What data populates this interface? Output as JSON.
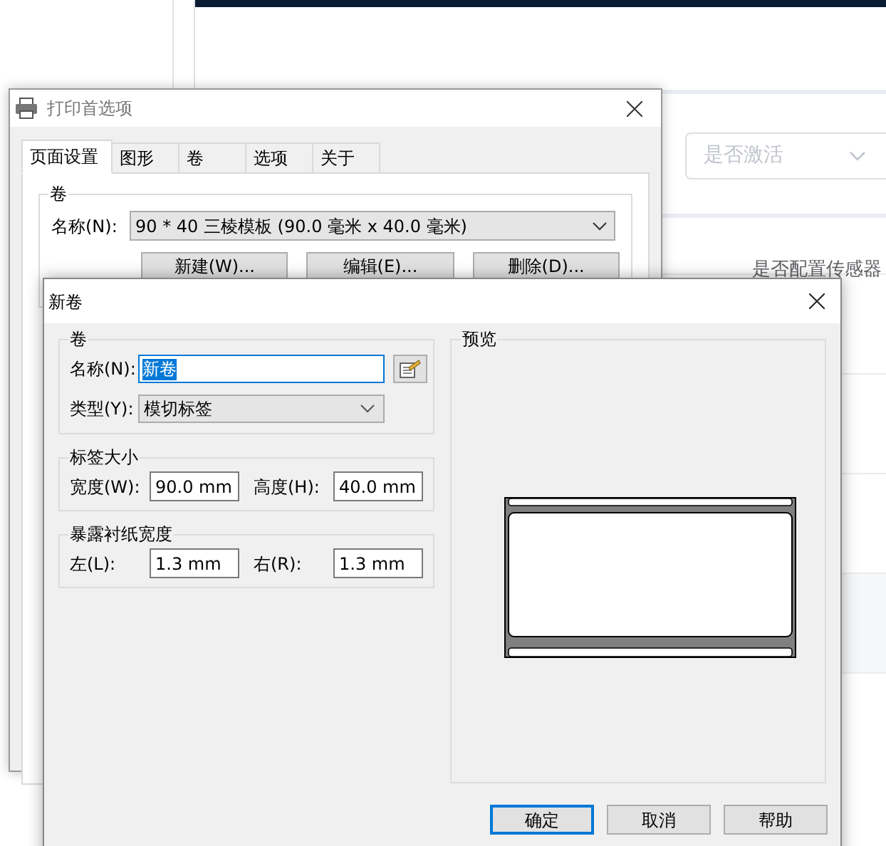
{
  "background_page": {
    "filter_select": {
      "placeholder": "是否激活"
    },
    "table": {
      "columns": [
        "是否配置传感器"
      ]
    }
  },
  "print_preferences_dialog": {
    "title": "打印首选项",
    "tabs": [
      {
        "label": "页面设置",
        "selected": true
      },
      {
        "label": "图形",
        "selected": false
      },
      {
        "label": "卷",
        "selected": false
      },
      {
        "label": "选项",
        "selected": false
      },
      {
        "label": "关于",
        "selected": false
      }
    ],
    "roll_group": {
      "title": "卷",
      "name_label": "名称(N):",
      "name_value": "90 * 40 三棱模板 (90.0 毫米 x 40.0 毫米)",
      "buttons": [
        "新建(W)...",
        "编辑(E)...",
        "删除(D)..."
      ]
    }
  },
  "new_roll_dialog": {
    "title": "新卷",
    "roll_group": {
      "title": "卷",
      "name_label": "名称(N):",
      "name_value": "新卷",
      "name_selected": true,
      "type_label": "类型(Y):",
      "type_value": "模切标签"
    },
    "label_size": {
      "title": "标签大小",
      "fields": [
        {
          "label": "宽度(W):",
          "value": "90.0 mm"
        },
        {
          "label": "高度(H):",
          "value": "40.0 mm"
        }
      ]
    },
    "exposed_liner_width": {
      "title": "暴露衬纸宽度",
      "fields": [
        {
          "label": "左(L):",
          "value": "1.3 mm"
        },
        {
          "label": "右(R):",
          "value": "1.3 mm"
        }
      ]
    },
    "preview": {
      "title": "预览"
    },
    "buttons": [
      {
        "label": "确定",
        "focused": true
      },
      {
        "label": "取消",
        "focused": false
      },
      {
        "label": "帮助",
        "focused": false
      }
    ]
  }
}
